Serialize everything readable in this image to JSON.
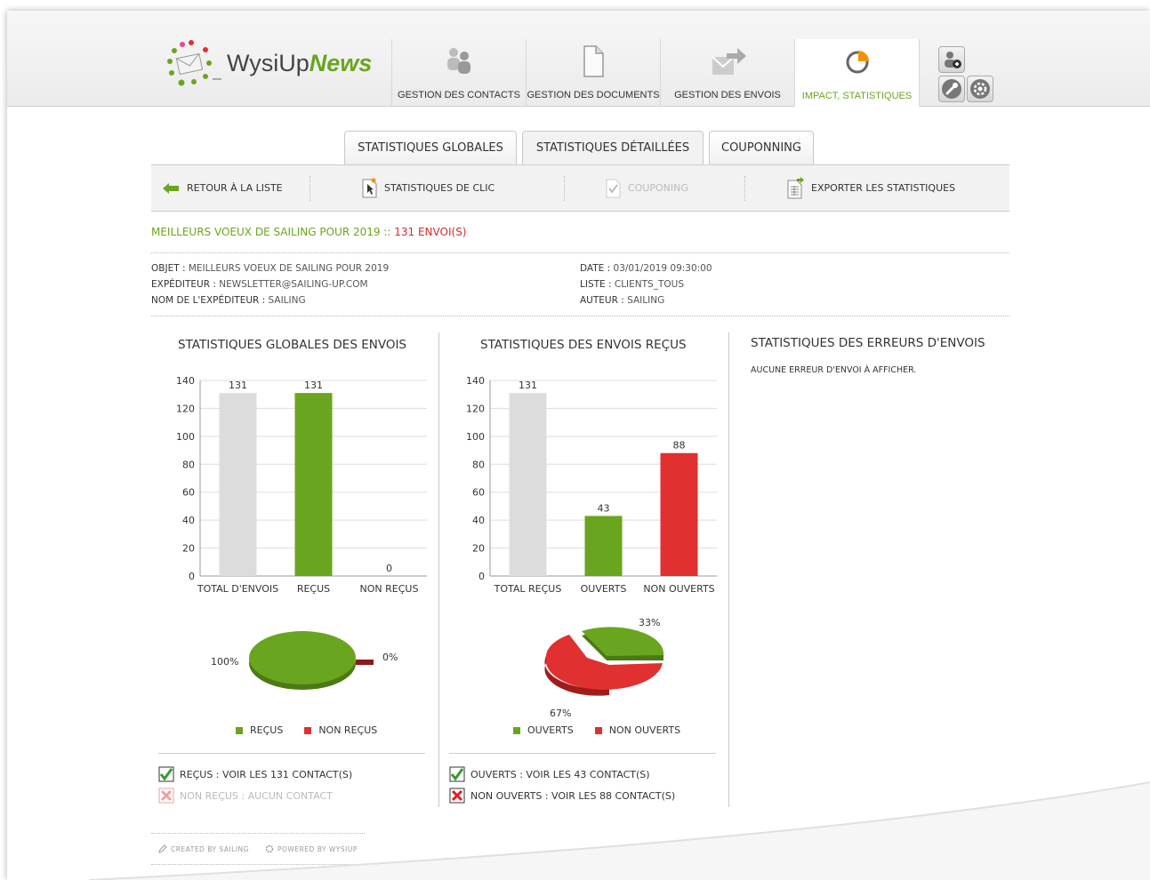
{
  "app": {
    "logo_text_plain": "WysiUp",
    "logo_text_accent": "News"
  },
  "nav": [
    {
      "label": "GESTION DES CONTACTS",
      "icon": "contacts-icon"
    },
    {
      "label": "GESTION DES DOCUMENTS",
      "icon": "document-icon"
    },
    {
      "label": "GESTION DES ENVOIS",
      "icon": "send-icon"
    },
    {
      "label": "IMPACT, STATISTIQUES",
      "icon": "pie-chart-icon",
      "active": true
    }
  ],
  "utility": [
    "add-user-icon",
    "wrench-icon",
    "gear-icon"
  ],
  "tabs": [
    {
      "label": "STATISTIQUES GLOBALES"
    },
    {
      "label": "STATISTIQUES DÉTAILLÉES",
      "active": true
    },
    {
      "label": "COUPONNING"
    }
  ],
  "toolbar": {
    "back": "RETOUR À LA LISTE",
    "click_stats": "STATISTIQUES DE CLIC",
    "couponing": "COUPONING",
    "export": "EXPORTER LES STATISTIQUES"
  },
  "campaign": {
    "title": "MEILLEURS VOEUX DE SAILING POUR 2019",
    "separator": " :: ",
    "count": "131 ENVOI(S)"
  },
  "details": {
    "objet_label": "OBJET : ",
    "objet": "MEILLEURS VOEUX DE SAILING POUR 2019",
    "expediteur_label": "EXPÉDITEUR : ",
    "expediteur": "NEWSLETTER@SAILING-UP.COM",
    "nom_label": "NOM DE L'EXPÉDITEUR : ",
    "nom": "SAILING",
    "date_label": "DATE : ",
    "date": "03/01/2019 09:30:00",
    "liste_label": "LISTE : ",
    "liste": "CLIENTS_TOUS",
    "auteur_label": "AUTEUR : ",
    "auteur": "SAILING"
  },
  "columns": {
    "global": "STATISTIQUES GLOBALES DES ENVOIS",
    "received": "STATISTIQUES DES ENVOIS REÇUS",
    "errors": "STATISTIQUES DES ERREURS D'ENVOIS",
    "no_errors": "AUCUNE ERREUR D'ENVOI À AFFICHER."
  },
  "colors": {
    "green": "#6aa51f",
    "red": "#e03030",
    "grey": "#dcdcdc",
    "darkred": "#8b1a1a"
  },
  "chart_data": [
    {
      "type": "bar",
      "categories": [
        "TOTAL D'ENVOIS",
        "REÇUS",
        "NON REÇUS"
      ],
      "values": [
        131,
        131,
        0
      ],
      "colors": [
        "#dcdcdc",
        "#6aa51f",
        "#e03030"
      ],
      "ylim": [
        0,
        140
      ],
      "yticks": [
        0,
        20,
        40,
        60,
        80,
        100,
        120,
        140
      ],
      "title": "",
      "xlabel": "",
      "ylabel": ""
    },
    {
      "type": "pie",
      "labels": [
        "REÇUS",
        "NON REÇUS"
      ],
      "values": [
        100,
        0
      ],
      "display": [
        "100%",
        "0%"
      ],
      "colors": [
        "#6aa51f",
        "#8b1a1a"
      ]
    },
    {
      "type": "bar",
      "categories": [
        "TOTAL REÇUS",
        "OUVERTS",
        "NON OUVERTS"
      ],
      "values": [
        131,
        43,
        88
      ],
      "colors": [
        "#dcdcdc",
        "#6aa51f",
        "#e03030"
      ],
      "ylim": [
        0,
        140
      ],
      "yticks": [
        0,
        20,
        40,
        60,
        80,
        100,
        120,
        140
      ],
      "title": "",
      "xlabel": "",
      "ylabel": ""
    },
    {
      "type": "pie",
      "labels": [
        "OUVERTS",
        "NON OUVERTS"
      ],
      "values": [
        33,
        67
      ],
      "display": [
        "33%",
        "67%"
      ],
      "colors": [
        "#6aa51f",
        "#e03030"
      ]
    }
  ],
  "legends": {
    "g1": "REÇUS",
    "g2": "NON REÇUS",
    "r1": "OUVERTS",
    "r2": "NON OUVERTS"
  },
  "links": {
    "recus": "REÇUS : VOIR LES 131 CONTACT(S)",
    "non_recus": "NON REÇUS : AUCUN CONTACT",
    "ouverts": "OUVERTS : VOIR LES 43 CONTACT(S)",
    "non_ouverts": "NON OUVERTS : VOIR LES 88 CONTACT(S)"
  },
  "footer": {
    "created": "CREATED BY SAILING",
    "powered": "POWERED BY WYSIUP"
  }
}
